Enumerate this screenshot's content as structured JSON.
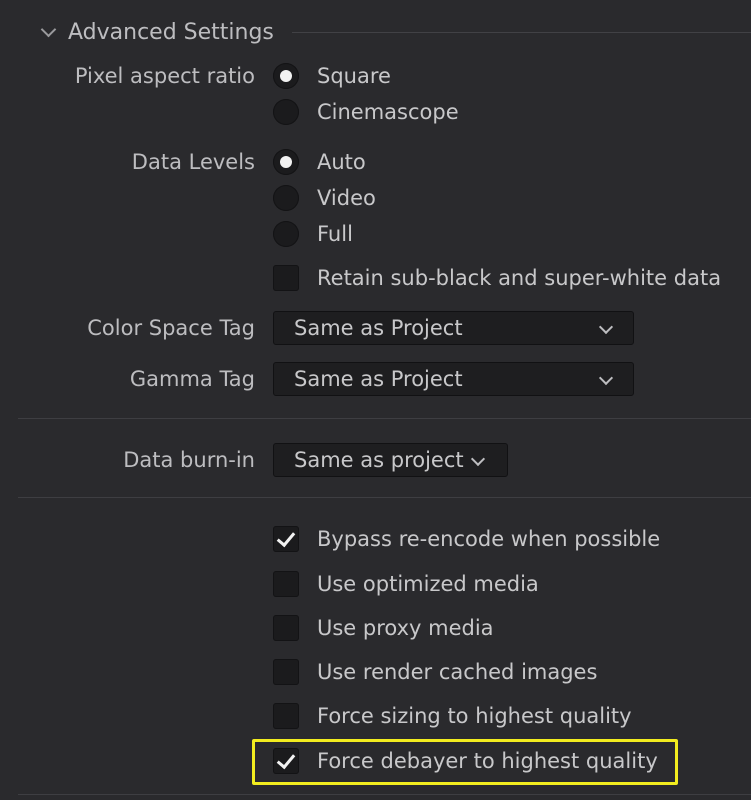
{
  "section": {
    "title": "Advanced Settings"
  },
  "pixel_aspect": {
    "label": "Pixel aspect ratio",
    "options": [
      {
        "label": "Square",
        "checked": true
      },
      {
        "label": "Cinemascope",
        "checked": false
      }
    ]
  },
  "data_levels": {
    "label": "Data Levels",
    "options": [
      {
        "label": "Auto",
        "checked": true
      },
      {
        "label": "Video",
        "checked": false
      },
      {
        "label": "Full",
        "checked": false
      }
    ],
    "retain": {
      "label": "Retain sub-black and super-white data",
      "checked": false
    }
  },
  "color_space": {
    "label": "Color Space Tag",
    "value": "Same as Project"
  },
  "gamma": {
    "label": "Gamma Tag",
    "value": "Same as Project"
  },
  "burn_in": {
    "label": "Data burn-in",
    "value": "Same as project"
  },
  "options": [
    {
      "label": "Bypass re-encode when possible",
      "checked": true
    },
    {
      "label": "Use optimized media",
      "checked": false
    },
    {
      "label": "Use proxy media",
      "checked": false
    },
    {
      "label": "Use render cached images",
      "checked": false
    },
    {
      "label": "Force sizing to highest quality",
      "checked": false
    },
    {
      "label": "Force debayer to highest quality",
      "checked": true
    }
  ],
  "colors": {
    "background": "#2a2a2d",
    "highlight": "#f2ec1f"
  }
}
